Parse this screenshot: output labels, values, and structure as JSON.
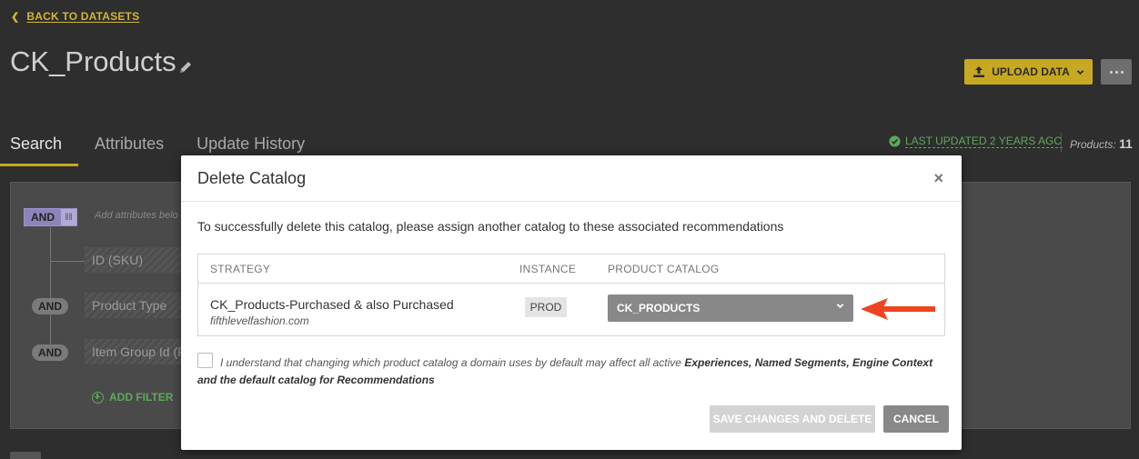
{
  "header": {
    "back_label": "BACK TO DATASETS",
    "title": "CK_Products",
    "upload_label": "UPLOAD DATA"
  },
  "tabs": [
    {
      "label": "Search",
      "active": true
    },
    {
      "label": "Attributes",
      "active": false
    },
    {
      "label": "Update History",
      "active": false
    }
  ],
  "status": {
    "last_updated": "LAST UPDATED 2 YEARS AGO",
    "products_label": "Products:",
    "products_count": "11"
  },
  "filters": {
    "root_operator": "AND",
    "add_attributes_hint": "Add attributes belo",
    "rows": [
      {
        "operator": "",
        "label": "ID (SKU)"
      },
      {
        "operator": "AND",
        "label": "Product Type"
      },
      {
        "operator": "AND",
        "label": "Item Group Id (P"
      }
    ],
    "add_filter_label": "ADD FILTER"
  },
  "modal": {
    "title": "Delete Catalog",
    "close_glyph": "×",
    "message": "To successfully delete this catalog, please assign another catalog to these associated recommendations",
    "table": {
      "headers": {
        "strategy": "STRATEGY",
        "instance": "INSTANCE",
        "catalog": "PRODUCT CATALOG"
      },
      "rows": [
        {
          "strategy": "CK_Products-Purchased & also Purchased",
          "domain": "fifthlevelfashion.com",
          "instance": "PROD",
          "catalog": "CK_PRODUCTS"
        }
      ]
    },
    "agree": {
      "checked": false,
      "text_plain": "I understand that changing which product catalog a domain uses by default may affect all active ",
      "text_bold": "Experiences, Named Segments, Engine Context and the default catalog for Recommendations"
    },
    "save_label": "SAVE CHANGES AND DELETE",
    "cancel_label": "CANCEL"
  },
  "colors": {
    "accent": "#c6a920",
    "success": "#5fa85b",
    "annotation_arrow": "#ef4420",
    "background": "#2e2e2e"
  }
}
